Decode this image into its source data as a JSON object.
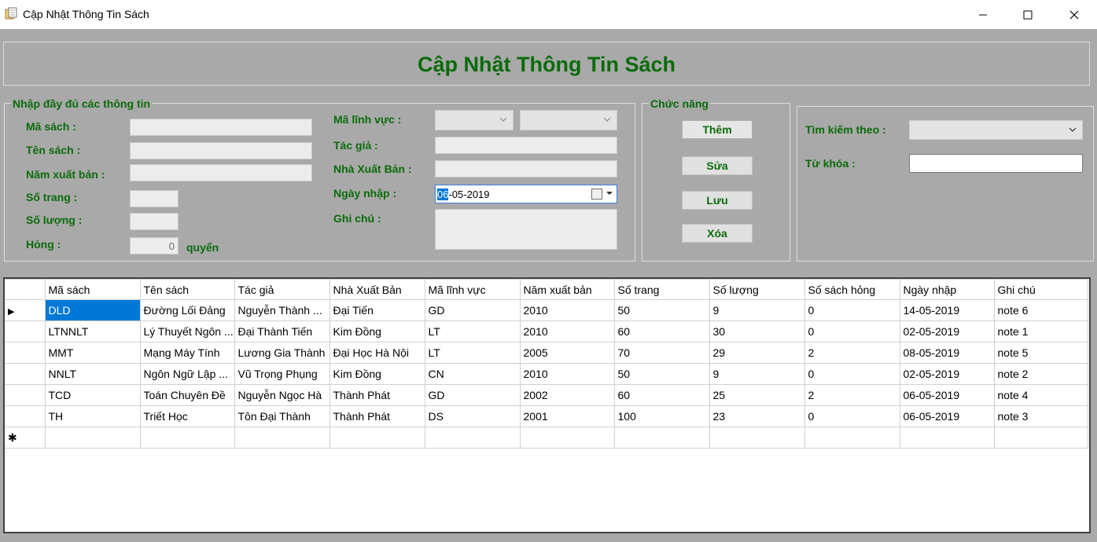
{
  "window": {
    "title": "Cập Nhật Thông Tin Sách",
    "minimize_icon": "—",
    "maximize_icon": "☐",
    "close_icon": "✕"
  },
  "header": {
    "title": "Cập Nhật Thông Tin Sách"
  },
  "input_group": {
    "title": "Nhập đầy đủ các thông tin",
    "ma_sach_label": "Mã sách :",
    "ten_sach_label": "Tên sách :",
    "nam_xb_label": "Năm xuất bản :",
    "so_trang_label": "Số trang :",
    "so_luong_label": "Số lượng :",
    "hong_label": "Hỏng :",
    "hong_value": "0",
    "hong_unit": "quyển",
    "ma_linh_vuc_label": "Mã lĩnh vực :",
    "tac_gia_label": "Tác giả :",
    "nxb_label": "Nhà Xuất Bản :",
    "ngay_nhap_label": "Ngày nhập :",
    "ngay_nhap_selected": "06",
    "ngay_nhap_rest": "-05-2019",
    "ghi_chu_label": "Ghi chú :"
  },
  "functions": {
    "title": "Chức năng",
    "add": "Thêm",
    "edit": "Sửa",
    "save": "Lưu",
    "delete": "Xóa"
  },
  "search": {
    "by_label": "Tìm kiếm theo :",
    "keyword_label": "Từ khóa :",
    "keyword_value": ""
  },
  "grid": {
    "columns": [
      "Mã sách",
      "Tên sách",
      "Tác giả",
      "Nhà Xuất Bản",
      "Mã lĩnh vực",
      "Năm xuất bản",
      "Số trang",
      "Số lượng",
      "Số sách hỏng",
      "Ngày nhập",
      "Ghi chú"
    ],
    "rows": [
      [
        "DLD",
        "Đường Lối Đảng",
        "Nguyễn Thành ...",
        "Đại Tiến",
        "GD",
        "2010",
        "50",
        "9",
        "0",
        "14-05-2019",
        "note 6"
      ],
      [
        "LTNNLT",
        "Lý Thuyết Ngôn ...",
        "Đại Thành Tiến",
        "Kim Đồng",
        "LT",
        "2010",
        "60",
        "30",
        "0",
        "02-05-2019",
        "note 1"
      ],
      [
        "MMT",
        "Mạng Máy Tính",
        "Lương Gia Thành",
        "Đại Học Hà Nội",
        "LT",
        "2005",
        "70",
        "29",
        "2",
        "08-05-2019",
        "note 5"
      ],
      [
        "NNLT",
        "Ngôn Ngữ Lập ...",
        "Vũ Trọng Phụng",
        "Kim Đồng",
        "CN",
        "2010",
        "50",
        "9",
        "0",
        "02-05-2019",
        "note 2"
      ],
      [
        "TCD",
        "Toán Chuyên Đề",
        "Nguyễn Ngọc Hà",
        "Thành Phát",
        "GD",
        "2002",
        "60",
        "25",
        "2",
        "06-05-2019",
        "note 4"
      ],
      [
        "TH",
        "Triết Học",
        "Tôn Đại Thành",
        "Thành Phát",
        "DS",
        "2001",
        "100",
        "23",
        "0",
        "06-05-2019",
        "note 3"
      ]
    ],
    "current_row_marker": "▶",
    "new_row_marker": "✱"
  }
}
